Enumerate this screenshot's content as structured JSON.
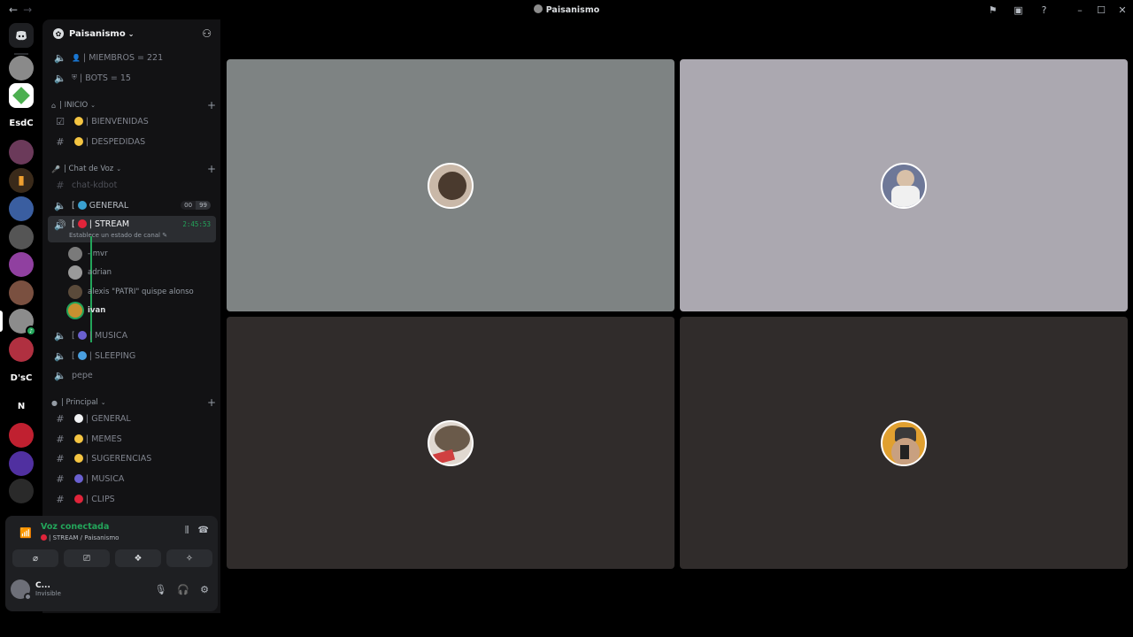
{
  "titlebar": {
    "title": "Paisanismo",
    "back_icon": "arrow-left-icon",
    "forward_icon": "arrow-right-icon"
  },
  "server": {
    "name": "Paisanismo"
  },
  "channels": {
    "miembros": "| MIEMBROS = 221",
    "bots": "| BOTS = 15",
    "cat_inicio": "| INICIO",
    "bienvenidas": "| BIENVENIDAS",
    "despedidas": "| DESPEDIDAS",
    "cat_voz": "| Chat de Voz",
    "chat_kdbot": "chat-kdbot",
    "general_voice": "GENERAL",
    "general_counts": [
      "00",
      "99"
    ],
    "stream": "STREAM",
    "stream_timer": "2:45:53",
    "stream_status": "Establece un estado de canal",
    "musica_voice": "MUSICA",
    "sleeping": "SLEEPING",
    "pepe": "pepe",
    "cat_principal": "| Principal",
    "general_text": "| GENERAL",
    "memes": "| MEMES",
    "sugerencias": "| SUGERENCIAS",
    "musica_text": "| MUSICA",
    "clips": "| CLIPS"
  },
  "voice_users": [
    {
      "name": "- mvr",
      "speaking": false
    },
    {
      "name": "adrian",
      "speaking": false
    },
    {
      "name": "alexis \"PATRI\" quispe alonso",
      "speaking": false
    },
    {
      "name": "ivan",
      "speaking": true
    }
  ],
  "guild_labels": {
    "esdc": "EsdC",
    "dsc": "D'sC",
    "n": "N"
  },
  "voice_connection": {
    "status": "Voz conectada",
    "location": "| STREAM / Paisanismo"
  },
  "account": {
    "name": "C...",
    "status": "Invisible"
  },
  "colors": {
    "tile1": "#7e8383",
    "tile2": "#aba8b0",
    "tile3": "#302c2b",
    "tile4": "#302c2b",
    "green": "#23a55a"
  }
}
